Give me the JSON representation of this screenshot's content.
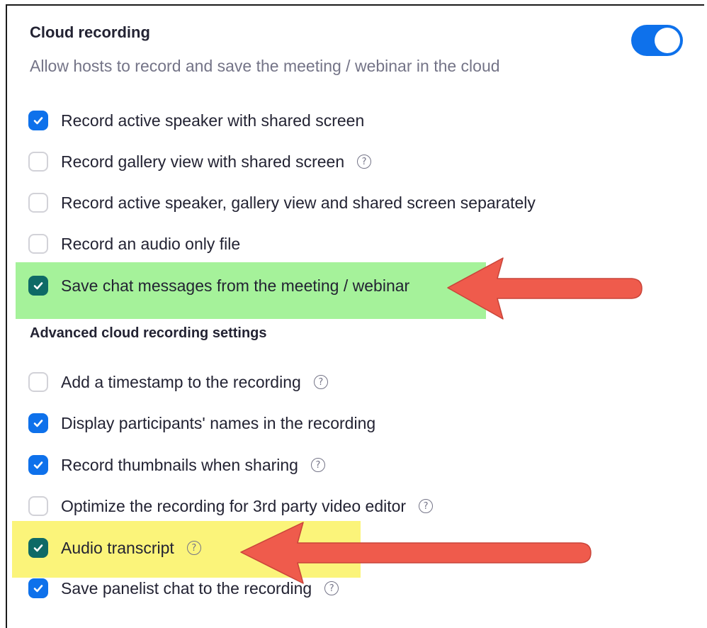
{
  "cloud_recording": {
    "title": "Cloud recording",
    "description": "Allow hosts to record and save the meeting / webinar in the cloud",
    "toggle_on": true
  },
  "options": [
    {
      "label": "Record active speaker with shared screen",
      "checked": true,
      "help": false
    },
    {
      "label": "Record gallery view with shared screen",
      "checked": false,
      "help": true
    },
    {
      "label": "Record active speaker, gallery view and shared screen separately",
      "checked": false,
      "help": false
    },
    {
      "label": "Record an audio only file",
      "checked": false,
      "help": false
    },
    {
      "label": "Save chat messages from the meeting / webinar",
      "checked": true,
      "help": false,
      "highlight": "green"
    }
  ],
  "advanced": {
    "title": "Advanced cloud recording settings",
    "options": [
      {
        "label": "Add a timestamp to the recording",
        "checked": false,
        "help": true
      },
      {
        "label": "Display participants' names in the recording",
        "checked": true,
        "help": false
      },
      {
        "label": "Record thumbnails when sharing",
        "checked": true,
        "help": true
      },
      {
        "label": "Optimize the recording for 3rd party video editor",
        "checked": false,
        "help": true
      },
      {
        "label": "Audio transcript",
        "checked": true,
        "help": true,
        "highlight": "yellow"
      },
      {
        "label": "Save panelist chat to the recording",
        "checked": true,
        "help": true
      }
    ]
  },
  "help_glyph": "?",
  "colors": {
    "accent": "#0e71eb",
    "highlight_green": "#a5f29a",
    "highlight_yellow": "#fbf47a",
    "arrow": "#ef5b4c"
  },
  "icons": [
    "check-icon",
    "help-icon",
    "red-arrow"
  ]
}
